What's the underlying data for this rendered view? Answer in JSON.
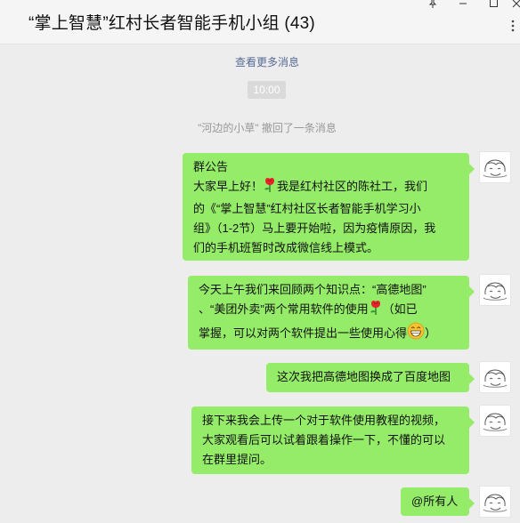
{
  "window": {
    "title": "“掌上智慧”红村长者智能手机小组 (43)"
  },
  "chat": {
    "view_more": "查看更多消息",
    "time": "10:00",
    "recall_notice": "\"河边的小草\" 撤回了一条消息"
  },
  "messages": [
    {
      "lines": [
        "群公告",
        "大家早上好！[rose]我是红村社区的陈社工，我们",
        "的《“掌上智慧”红村社区长者智能手机学习小",
        "组》（1-2节）马上要开始啦，因为疫情原因，我",
        "们的手机班暂时改成微信线上模式。"
      ],
      "l1_a": "大家早上好！",
      "l1_b": "我是红村社区的陈社工，我们",
      "l0": "群公告",
      "l2": "的《“掌上智慧”红村社区长者智能手机学习小",
      "l3": "组》（1-2节）马上要开始啦，因为疫情原因，我",
      "l4": "们的手机班暂时改成微信线上模式。"
    },
    {
      "l0": "今天上午我们来回顾两个知识点：“高德地图”",
      "l1_a": "、“美团外卖”两个常用软件的使用",
      "l1_b": "（如已",
      "l2_a": "掌握，可以对两个软件提出一些使用心得",
      "l2_b": "）"
    },
    {
      "l0": "这次我把高德地图换成了百度地图"
    },
    {
      "l0": "接下来我会上传一个对于软件使用教程的视频，",
      "l1": "大家观看后可以试着跟着操作一下，不懂的可以",
      "l2": "在群里提问。"
    },
    {
      "l0": "@所有人"
    }
  ],
  "icons": {
    "pin": "pin-icon",
    "minimize": "minimize-icon",
    "maximize": "maximize-icon",
    "close": "close-icon",
    "more": "more-icon",
    "rose": "rose-emoji-icon",
    "grin": "grin-emoji-icon",
    "avatar": "sketch-avatar"
  },
  "colors": {
    "bubble": "#95ec69",
    "link": "#576b95",
    "background": "#ededed"
  }
}
